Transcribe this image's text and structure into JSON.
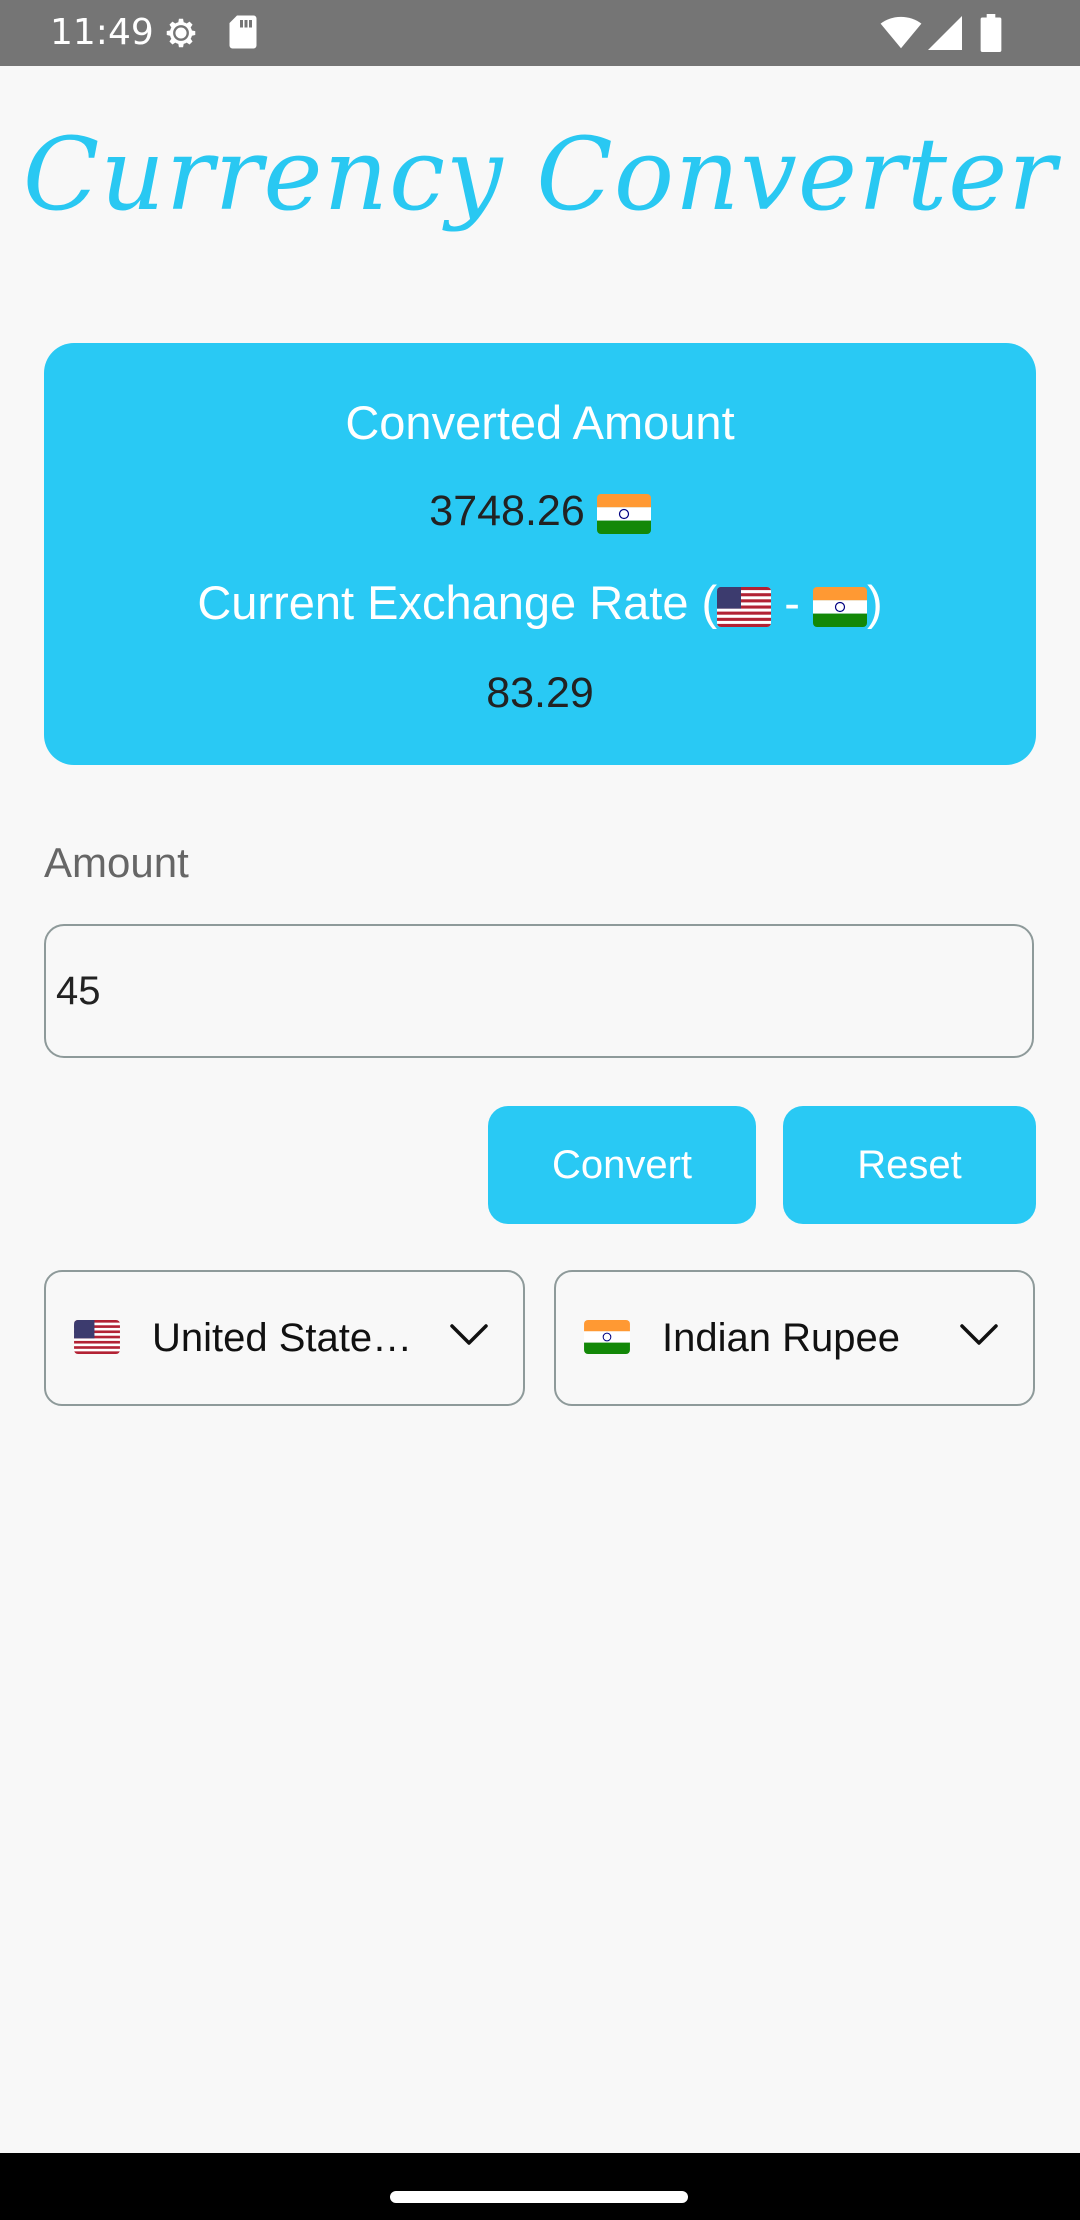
{
  "status_bar": {
    "time": "11:49",
    "left_icons": [
      "settings-gear-icon",
      "sd-card-icon"
    ],
    "right_icons": [
      "wifi-icon",
      "cellular-signal-icon",
      "battery-icon"
    ]
  },
  "app": {
    "title": "Currency Converter"
  },
  "result_card": {
    "heading": "Converted Amount",
    "converted_value": "3748.26",
    "rate_label_prefix": "Current Exchange Rate (",
    "rate_label_separator": " - ",
    "rate_label_suffix": ")",
    "exchange_rate": "83.29",
    "from_flag": "us-flag-icon",
    "to_flag": "india-flag-icon"
  },
  "amount": {
    "label": "Amount",
    "value": "45"
  },
  "buttons": {
    "convert": "Convert",
    "reset": "Reset"
  },
  "currency_selectors": {
    "from": {
      "label": "United States…",
      "flag": "us-flag-icon"
    },
    "to": {
      "label": "Indian Rupee",
      "flag": "india-flag-icon"
    }
  },
  "colors": {
    "accent": "#29C9F4",
    "status_bar": "#757575",
    "background": "#F8F8F8"
  }
}
